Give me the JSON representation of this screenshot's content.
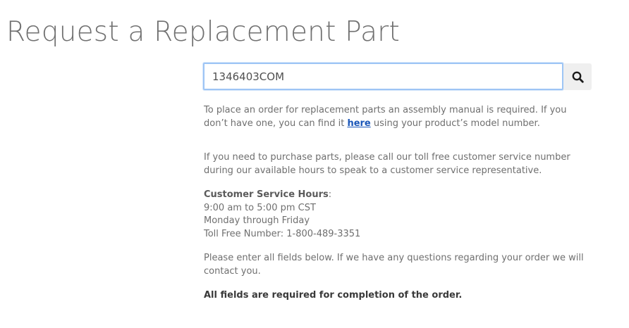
{
  "page": {
    "title": "Request a Replacement Part"
  },
  "search": {
    "value": "1346403COM",
    "button_icon": "search-icon"
  },
  "info": {
    "order_text_before": "To place an order for replacement parts an assembly manual is required. If you don’t have one, you can find it ",
    "order_link": "here",
    "order_text_after": " using your product’s model number.",
    "purchase_text": "If you need to purchase parts, please call our toll free customer service number during our available hours to speak to a customer service representative.",
    "hours_label": "Customer Service Hours",
    "hours_colon": ":",
    "hours_time": "9:00 am to 5:00 pm CST",
    "hours_days": "Monday through Friday",
    "toll_free": "Toll Free Number: 1-800-489-3351",
    "enter_fields_text": "Please enter all fields below. If we have any questions regarding your order we will contact you.",
    "required_text": "All fields are required for completion of the order."
  },
  "colors": {
    "link": "#1a56b8",
    "input_focus_border": "#9ec5f5",
    "search_button_bg": "#efefef"
  }
}
